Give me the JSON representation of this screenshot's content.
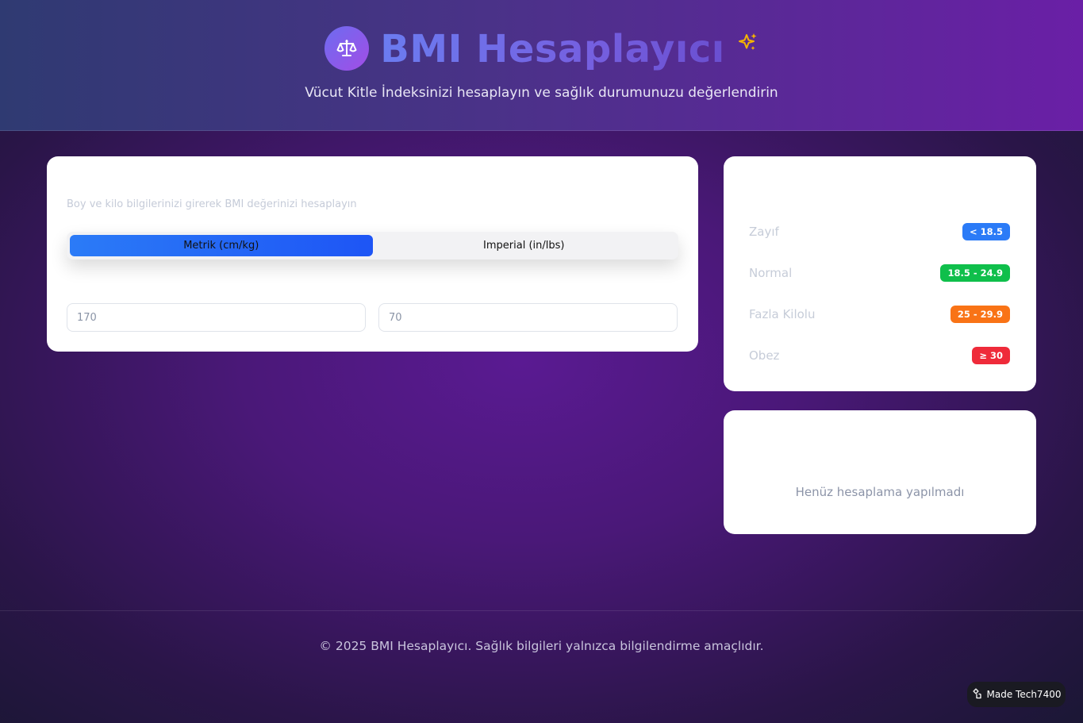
{
  "header": {
    "logo_icon": "balance-scale-icon",
    "title": "BMI Hesaplayıcı",
    "title_icon": "sparkles-icon",
    "subtitle": "Vücut Kitle İndeksinizi hesaplayın ve sağlık durumunuzu değerlendirin"
  },
  "calculator": {
    "description": "Boy ve kilo bilgilerinizi girerek BMI değerinizi hesaplayın",
    "units": [
      {
        "label": "Metrik (cm/kg)",
        "active": true
      },
      {
        "label": "Imperial (in/lbs)",
        "active": false
      }
    ],
    "height_placeholder": "170",
    "weight_placeholder": "70"
  },
  "categories": [
    {
      "name": "Zayıf",
      "range": "< 18.5",
      "color": "#2b7bf7"
    },
    {
      "name": "Normal",
      "range": "18.5 - 24.9",
      "color": "#0fbf4b"
    },
    {
      "name": "Fazla Kilolu",
      "range": "25 - 29.9",
      "color": "#f97316"
    },
    {
      "name": "Obez",
      "range": "≥ 30",
      "color": "#ef2b3a"
    }
  ],
  "result": {
    "empty_text": "Henüz hesaplama yapılmadı"
  },
  "footer": {
    "text": "© 2025 BMI Hesaplayıcı. Sağlık bilgileri yalnızca bilgilendirme amaçlıdır."
  },
  "badge": {
    "icon": "gear-hand-icon",
    "label": "Made Tech7400"
  },
  "colors": {
    "accent_blue": "#1e55f5",
    "title_gradient_start": "#6b7cf0",
    "title_gradient_end": "#6a4fd0"
  }
}
